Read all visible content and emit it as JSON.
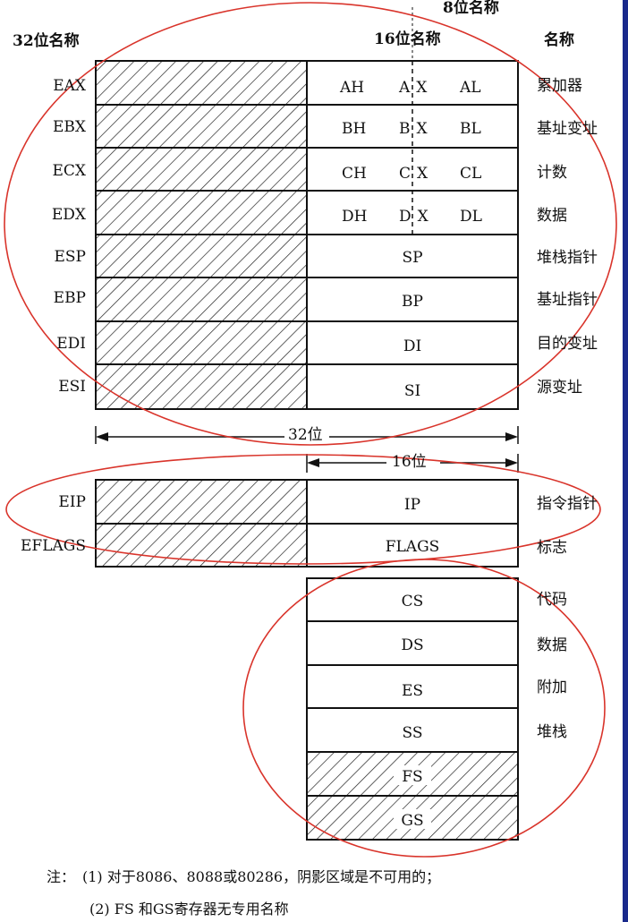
{
  "header": {
    "col32": "32位名称",
    "col16": "16位名称",
    "col8": "8位名称",
    "colName": "名称"
  },
  "general": [
    {
      "r32": "EAX",
      "hi": "AH",
      "x": "AX",
      "lo": "AL",
      "name": "累加器"
    },
    {
      "r32": "EBX",
      "hi": "BH",
      "x": "BX",
      "lo": "BL",
      "name": "基址变址"
    },
    {
      "r32": "ECX",
      "hi": "CH",
      "x": "CX",
      "lo": "CL",
      "name": "计数"
    },
    {
      "r32": "EDX",
      "hi": "DH",
      "x": "DX",
      "lo": "DL",
      "name": "数据"
    }
  ],
  "pointer": [
    {
      "r32": "ESP",
      "r16": "SP",
      "name": "堆栈指针"
    },
    {
      "r32": "EBP",
      "r16": "BP",
      "name": "基址指针"
    },
    {
      "r32": "EDI",
      "r16": "DI",
      "name": "目的变址"
    },
    {
      "r32": "ESI",
      "r16": "SI",
      "name": "源变址"
    }
  ],
  "widths": {
    "w32": "32位",
    "w16": "16位"
  },
  "control": [
    {
      "r32": "EIP",
      "r16": "IP",
      "name": "指令指针"
    },
    {
      "r32": "EFLAGS",
      "r16": "FLAGS",
      "name": "标志"
    }
  ],
  "segment": [
    {
      "r16": "CS",
      "name": "代码"
    },
    {
      "r16": "DS",
      "name": "数据"
    },
    {
      "r16": "ES",
      "name": "附加"
    },
    {
      "r16": "SS",
      "name": "堆栈"
    },
    {
      "r16": "FS",
      "name": ""
    },
    {
      "r16": "GS",
      "name": ""
    }
  ],
  "notes": {
    "prefix": "注：",
    "n1": "(1) 对于8086、8088或80286，阴影区域是不可用的；",
    "n2": "(2) FS 和GS寄存器无专用名称"
  },
  "colors": {
    "circle": "#d9342b",
    "bar": "#1a2a8c"
  }
}
